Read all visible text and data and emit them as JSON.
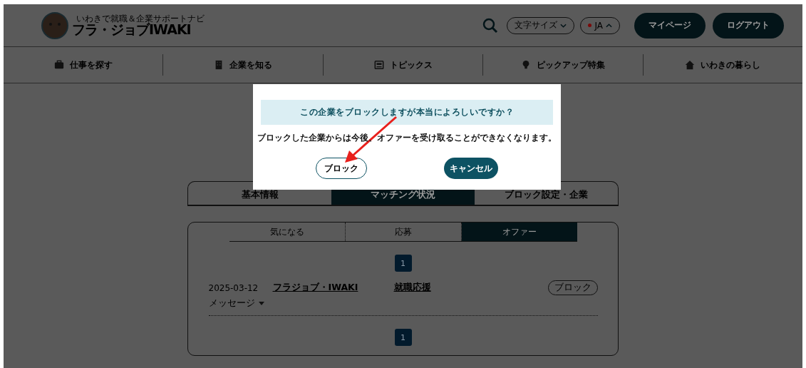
{
  "header": {
    "logo_tagline": "いわきで就職＆企業サポートナビ",
    "logo_title": "フラ・ジョブIWAKI",
    "font_size_button": "文字サイズ",
    "language_button": "JA",
    "buttons": [
      "マイページ",
      "ログアウト"
    ]
  },
  "nav": [
    "仕事を探す",
    "企業を知る",
    "トピックス",
    "ピックアップ特集",
    "いわきの暮らし"
  ],
  "tabs": [
    {
      "label": "基本情報",
      "selected": false
    },
    {
      "label": "マッチング状況",
      "selected": true
    },
    {
      "label": "ブロック設定・企業",
      "selected": false
    }
  ],
  "subtabs": [
    {
      "label": "気になる",
      "selected": false
    },
    {
      "label": "応募",
      "selected": false
    },
    {
      "label": "オファー",
      "selected": true
    }
  ],
  "pager_top": [
    {
      "label": "1",
      "selected": true
    }
  ],
  "rows": [
    {
      "date": "2025-03-12",
      "company": "フラジョブ・IWAKI",
      "type": "就職応援",
      "block_button": "ブロック",
      "message_toggle": "メッセージ"
    }
  ],
  "pager_bottom": [
    {
      "label": "1",
      "selected": true
    }
  ],
  "modal": {
    "title": "この企業をブロックしますが本当によろしいですか？",
    "body": "ブロックした企業からは今後、オファーを受け取ることができなくなります。",
    "confirm": "ブロック",
    "cancel": "キャンセル"
  }
}
